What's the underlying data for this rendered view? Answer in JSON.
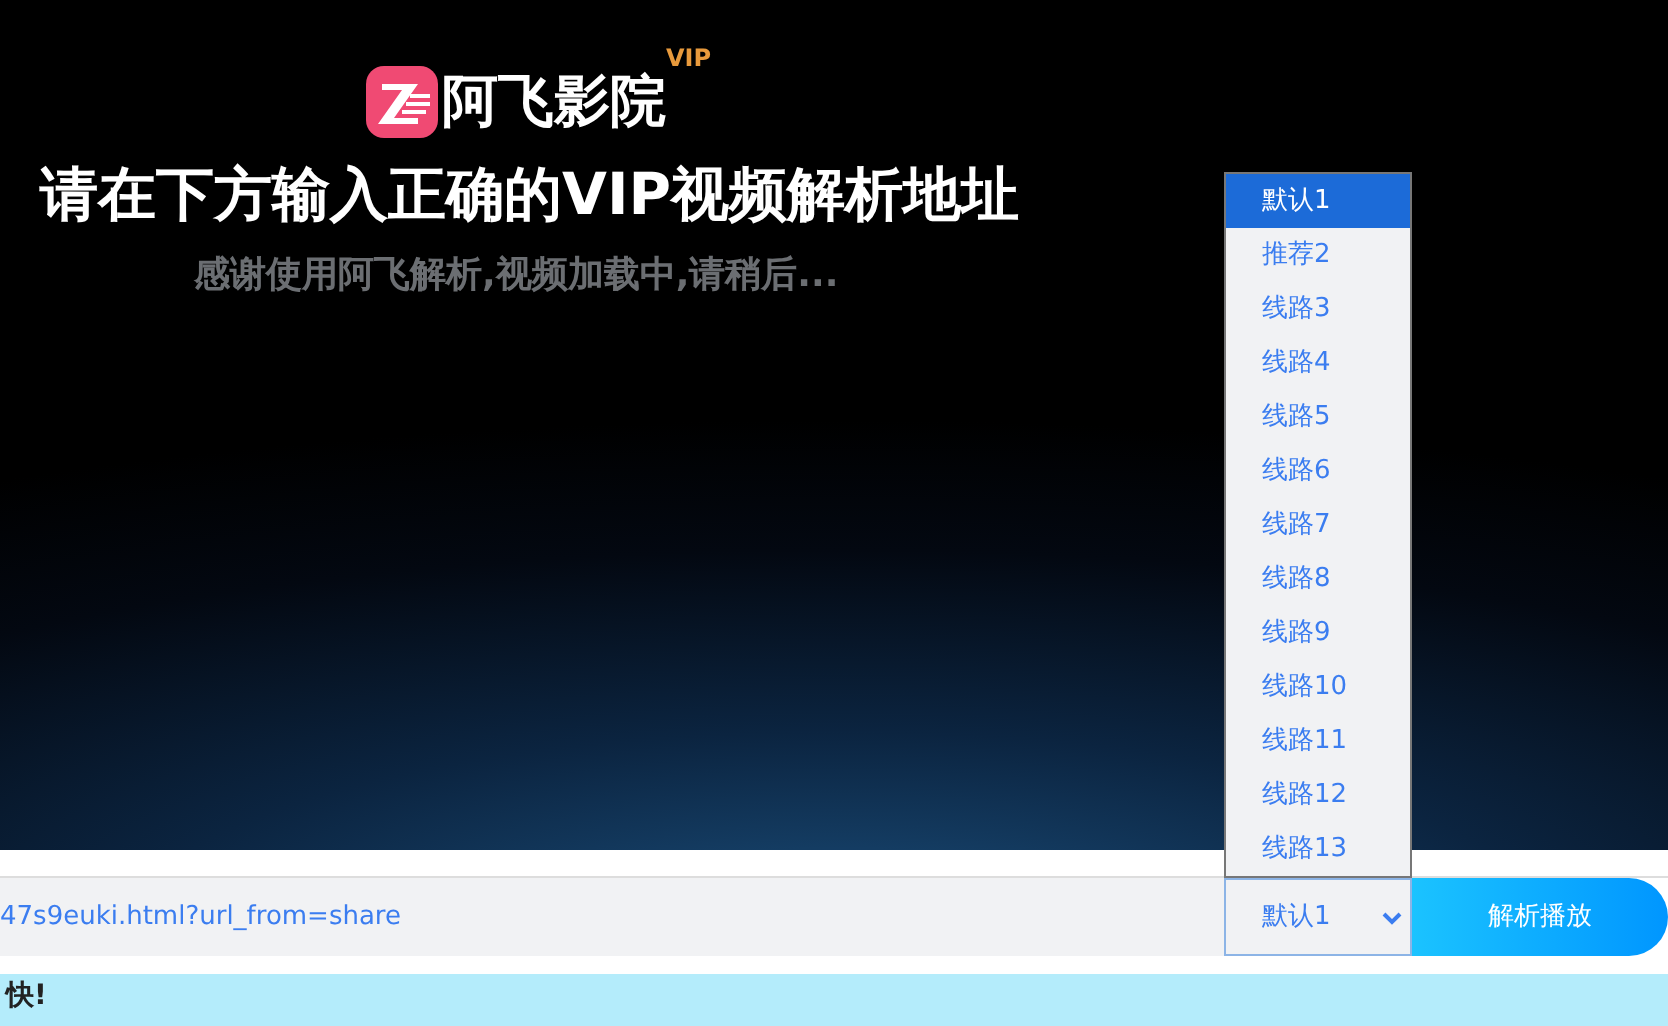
{
  "logo": {
    "name": "阿飞影院",
    "badge": "VIP"
  },
  "title": "请在下方输入正确的VIP视频解析地址",
  "subtitle": "感谢使用阿飞解析,视频加载中,请稍后...",
  "url_input": {
    "value": "47s9euki.html?url_from=share"
  },
  "route_select": {
    "value": "默认1",
    "expanded": true,
    "options": [
      {
        "label": "默认1",
        "selected": true
      },
      {
        "label": "推荐2",
        "selected": false
      },
      {
        "label": "线路3",
        "selected": false
      },
      {
        "label": "线路4",
        "selected": false
      },
      {
        "label": "线路5",
        "selected": false
      },
      {
        "label": "线路6",
        "selected": false
      },
      {
        "label": "线路7",
        "selected": false
      },
      {
        "label": "线路8",
        "selected": false
      },
      {
        "label": "线路9",
        "selected": false
      },
      {
        "label": "线路10",
        "selected": false
      },
      {
        "label": "线路11",
        "selected": false
      },
      {
        "label": "线路12",
        "selected": false
      },
      {
        "label": "线路13",
        "selected": false
      }
    ]
  },
  "play_button": "解析播放",
  "notice": "快!"
}
